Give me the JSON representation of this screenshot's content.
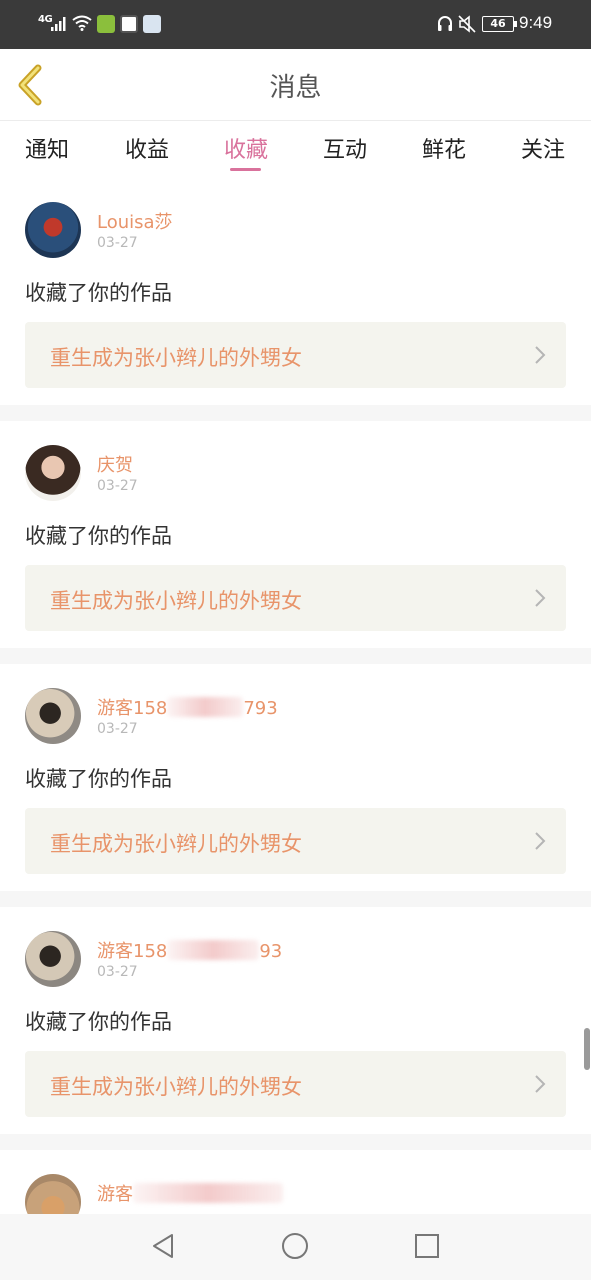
{
  "status_bar": {
    "network": "4G",
    "battery": "46",
    "time": "9:49"
  },
  "header": {
    "title": "消息"
  },
  "tabs": [
    {
      "label": "通知"
    },
    {
      "label": "收益"
    },
    {
      "label": "收藏"
    },
    {
      "label": "互动"
    },
    {
      "label": "鲜花"
    },
    {
      "label": "关注"
    }
  ],
  "active_tab": "收藏",
  "notifications": [
    {
      "user": "Louisa莎",
      "user_suffix": "",
      "date": "03-27",
      "action": "收藏了你的作品",
      "work": "重生成为张小辫儿的外甥女"
    },
    {
      "user": "庆贺",
      "user_suffix": "",
      "date": "03-27",
      "action": "收藏了你的作品",
      "work": "重生成为张小辫儿的外甥女"
    },
    {
      "user": "游客158",
      "user_suffix": "793",
      "date": "03-27",
      "action": "收藏了你的作品",
      "work": "重生成为张小辫儿的外甥女"
    },
    {
      "user": "游客158",
      "user_suffix": "93",
      "date": "03-27",
      "action": "收藏了你的作品",
      "work": "重生成为张小辫儿的外甥女"
    },
    {
      "user": "游客",
      "user_suffix": ""
    }
  ],
  "colors": {
    "accent": "#d9729c",
    "username": "#e8946a",
    "card_link_bg": "#f4f4ee"
  }
}
